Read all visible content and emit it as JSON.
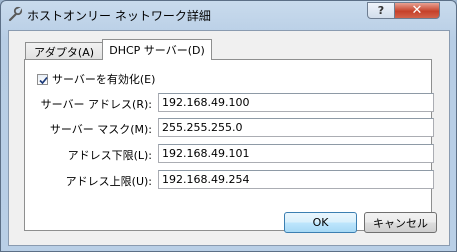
{
  "window": {
    "title": "ホストオンリー ネットワーク詳細",
    "help_label": "?",
    "close_label": "✕"
  },
  "tabs": [
    {
      "label": "アダプタ(A)",
      "active": false
    },
    {
      "label": "DHCP サーバー(D)",
      "active": true
    }
  ],
  "dhcp": {
    "enable_label": "サーバーを有効化(E)",
    "enabled": true,
    "fields": [
      {
        "label": "サーバー アドレス(R):",
        "value": "192.168.49.100"
      },
      {
        "label": "サーバー マスク(M):",
        "value": "255.255.255.0"
      },
      {
        "label": "アドレス下限(L):",
        "value": "192.168.49.101"
      },
      {
        "label": "アドレス上限(U):",
        "value": "192.168.49.254"
      }
    ]
  },
  "buttons": {
    "ok": "OK",
    "cancel": "キャンセル"
  }
}
